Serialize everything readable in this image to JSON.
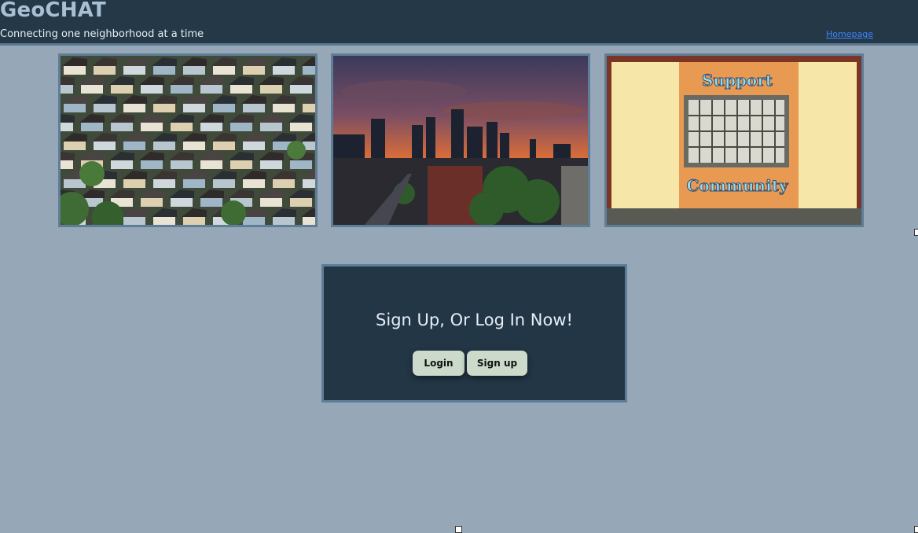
{
  "header": {
    "title": "GeoCHAT",
    "tagline": "Connecting one neighborhood at a time",
    "home_link": "Homepage"
  },
  "gallery": [
    {
      "subject": "aerial-suburban-houses"
    },
    {
      "subject": "city-skyline-sunset"
    },
    {
      "subject": "wall-with-window",
      "sign_top": "Support",
      "sign_bottom": "Community"
    }
  ],
  "cta": {
    "heading": "Sign Up, Or Log In Now!",
    "login_label": "Login",
    "signup_label": "Sign up"
  },
  "colors": {
    "page_bg": "#96a8b8",
    "header_bg": "#253848",
    "panel_bg": "#233646",
    "button_bg": "#cbdaca",
    "link": "#3d86ff"
  }
}
